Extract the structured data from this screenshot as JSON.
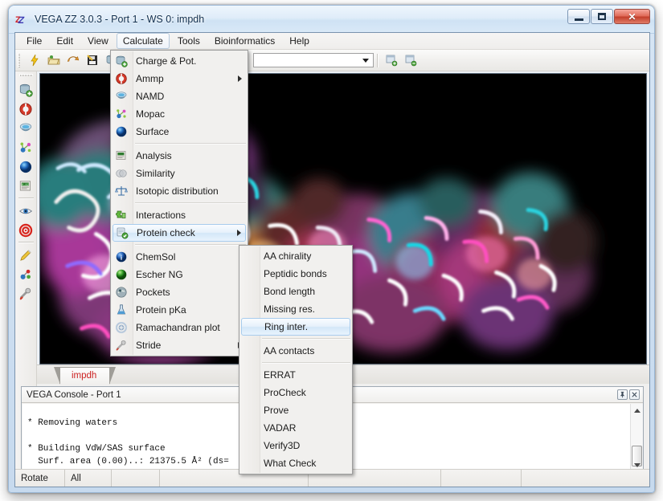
{
  "window": {
    "title": "VEGA ZZ 3.0.3 - Port 1 - WS 0: impdh",
    "app_icon": "zz-logo-icon",
    "buttons": {
      "minimize": "minimize-button",
      "maximize": "maximize-button",
      "close": "✕"
    }
  },
  "menubar": {
    "items": [
      {
        "label": "File",
        "active": false
      },
      {
        "label": "Edit",
        "active": false
      },
      {
        "label": "View",
        "active": false
      },
      {
        "label": "Calculate",
        "active": true
      },
      {
        "label": "Tools",
        "active": false
      },
      {
        "label": "Bioinformatics",
        "active": false
      },
      {
        "label": "Help",
        "active": false
      }
    ]
  },
  "toolbar": {
    "buttons": [
      {
        "name": "lightning-icon",
        "glyph": "⚡",
        "color": "#f2c200"
      },
      {
        "name": "open-folder-icon",
        "glyph": "📂",
        "color": "#d8bb63"
      },
      {
        "name": "undo-icon",
        "glyph": "↩",
        "color": "#d88c2a"
      },
      {
        "name": "save-icon",
        "glyph": "💾",
        "color": "#3a3a3a"
      },
      {
        "name": "database-add-icon",
        "glyph": "🗄",
        "color": "#4d8f3c"
      },
      {
        "name": "measure-icon",
        "glyph": "⌐",
        "color": "#6b6b6b"
      },
      {
        "name": "clipboard-icon",
        "glyph": "📋",
        "color": "#3a3a3a"
      },
      {
        "name": "bar-chart-icon",
        "glyph": "📊",
        "color": "#cc3b2a"
      },
      {
        "name": "pencil-icon",
        "glyph": "✏",
        "color": "#e0a81f"
      },
      {
        "name": "help-icon",
        "glyph": "?",
        "color": "#2f6fb5"
      }
    ],
    "combo_value": "",
    "combo_placeholder": "",
    "right_buttons": [
      {
        "name": "window-add-icon"
      },
      {
        "name": "window-remove-icon"
      }
    ]
  },
  "left_toolbar": {
    "buttons": [
      {
        "name": "database-add-icon"
      },
      {
        "name": "ammp-icon"
      },
      {
        "name": "namd-icon"
      },
      {
        "name": "mopac-icon"
      },
      {
        "name": "surface-icon"
      },
      {
        "name": "analysis-icon"
      },
      {
        "name": "eye-icon"
      },
      {
        "name": "target-icon"
      },
      {
        "name": "pencil-icon"
      },
      {
        "name": "molecule-icon"
      },
      {
        "name": "tool-icon"
      }
    ]
  },
  "viewport": {
    "name": "molecular-3d-viewport",
    "background": "#000000",
    "description": "Protein surface and ribbon rendering (IMPDH)"
  },
  "document_tab": {
    "label": "impdh",
    "color": "#cc2222"
  },
  "calculate_menu": {
    "items": [
      {
        "label": "Charge & Pot.",
        "icon": "charge-pot-icon",
        "submenu": false,
        "separator_after": false,
        "highlighted": false
      },
      {
        "label": "Ammp",
        "icon": "ammp-icon",
        "submenu": true,
        "separator_after": false,
        "highlighted": false
      },
      {
        "label": "NAMD",
        "icon": "namd-icon",
        "submenu": false,
        "separator_after": false,
        "highlighted": false
      },
      {
        "label": "Mopac",
        "icon": "mopac-icon",
        "submenu": false,
        "separator_after": false,
        "highlighted": false
      },
      {
        "label": "Surface",
        "icon": "surface-icon",
        "submenu": false,
        "separator_after": true,
        "highlighted": false
      },
      {
        "label": "Analysis",
        "icon": "analysis-icon",
        "submenu": false,
        "separator_after": false,
        "highlighted": false
      },
      {
        "label": "Similarity",
        "icon": "similarity-icon",
        "submenu": false,
        "separator_after": false,
        "highlighted": false
      },
      {
        "label": "Isotopic distribution",
        "icon": "isotopic-distribution-icon",
        "submenu": false,
        "separator_after": true,
        "highlighted": false
      },
      {
        "label": "Interactions",
        "icon": "interactions-icon",
        "submenu": false,
        "separator_after": false,
        "highlighted": false
      },
      {
        "label": "Protein check",
        "icon": "protein-check-icon",
        "submenu": true,
        "separator_after": true,
        "highlighted": true
      },
      {
        "label": "ChemSol",
        "icon": "chemsol-icon",
        "submenu": false,
        "separator_after": false,
        "highlighted": false
      },
      {
        "label": "Escher NG",
        "icon": "escher-ng-icon",
        "submenu": false,
        "separator_after": false,
        "highlighted": false
      },
      {
        "label": "Pockets",
        "icon": "pockets-icon",
        "submenu": false,
        "separator_after": false,
        "highlighted": false
      },
      {
        "label": "Protein pKa",
        "icon": "protein-pka-icon",
        "submenu": false,
        "separator_after": false,
        "highlighted": false
      },
      {
        "label": "Ramachandran plot",
        "icon": "ramachandran-plot-icon",
        "submenu": false,
        "separator_after": false,
        "highlighted": false
      },
      {
        "label": "Stride",
        "icon": "stride-icon",
        "submenu": true,
        "separator_after": false,
        "highlighted": false
      }
    ]
  },
  "protein_check_submenu": {
    "items": [
      {
        "label": "AA chirality",
        "separator_after": false,
        "highlighted": false
      },
      {
        "label": "Peptidic bonds",
        "separator_after": false,
        "highlighted": false
      },
      {
        "label": "Bond length",
        "separator_after": false,
        "highlighted": false
      },
      {
        "label": "Missing res.",
        "separator_after": false,
        "highlighted": false
      },
      {
        "label": "Ring inter.",
        "separator_after": true,
        "highlighted": true
      },
      {
        "label": "AA contacts",
        "separator_after": true,
        "highlighted": false
      },
      {
        "label": "ERRAT",
        "separator_after": false,
        "highlighted": false
      },
      {
        "label": "ProCheck",
        "separator_after": false,
        "highlighted": false
      },
      {
        "label": "Prove",
        "separator_after": false,
        "highlighted": false
      },
      {
        "label": "VADAR",
        "separator_after": false,
        "highlighted": false
      },
      {
        "label": "Verify3D",
        "separator_after": false,
        "highlighted": false
      },
      {
        "label": "What Check",
        "separator_after": false,
        "highlighted": false
      }
    ]
  },
  "console": {
    "title": "VEGA Console - Port 1",
    "text": "* Removing waters\n\n* Building VdW/SAS surface\n  Surf. area (0.00)..: 21375.5 Å² (ds=",
    "pin_button": "pin-icon",
    "close_button": "close-icon"
  },
  "statusbar": {
    "cells": [
      {
        "label": "Rotate",
        "width": 62
      },
      {
        "label": "All",
        "width": 58
      },
      {
        "label": "",
        "width": 60
      },
      {
        "label": "",
        "width": 185
      },
      {
        "label": "",
        "width": 165
      },
      {
        "label": "",
        "width": 100
      },
      {
        "label": "",
        "width": 160
      }
    ]
  },
  "colors": {
    "accent": "#2f6fb5",
    "highlight": "#d4e7f8",
    "frame": "#c7daee",
    "tab_text": "#cc2222"
  }
}
